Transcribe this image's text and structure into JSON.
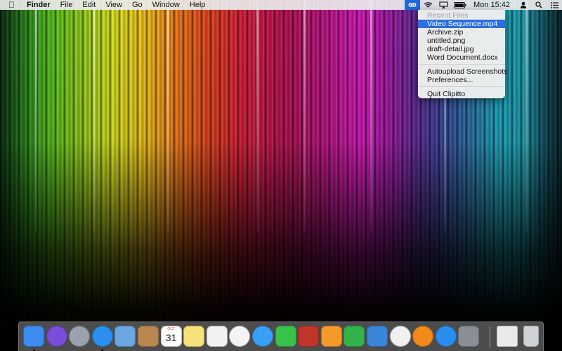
{
  "menubar": {
    "app_name": "Finder",
    "menus": [
      "File",
      "Edit",
      "View",
      "Go",
      "Window",
      "Help"
    ],
    "status_icons": [
      "clipitto-link-icon",
      "wifi-icon",
      "airplay-icon",
      "battery-icon"
    ],
    "clock": "Mon 15:42",
    "right_icons": [
      "user-icon",
      "search-icon",
      "list-icon"
    ]
  },
  "dropdown": {
    "header": "Recent Files",
    "recent_files": [
      "Video Sequence.mp4",
      "Archive.zip",
      "untitled.png",
      "draft-detail.jpg",
      "Word Document.docx"
    ],
    "selected_index": 0,
    "actions": [
      "Autoupload Screenshots",
      "Preferences..."
    ],
    "quit": "Quit Clipitto"
  },
  "dock": {
    "apps": [
      {
        "name": "finder-icon",
        "color": "#3d8df0",
        "running": true
      },
      {
        "name": "siri-icon",
        "color": "#7b4cd8",
        "running": false
      },
      {
        "name": "launchpad-icon",
        "color": "#9aa3ad",
        "running": false
      },
      {
        "name": "safari-icon",
        "color": "#2b8ff0",
        "running": true
      },
      {
        "name": "mail-icon",
        "color": "#6aa7e0",
        "running": false
      },
      {
        "name": "contacts-icon",
        "color": "#b9874f",
        "running": false
      },
      {
        "name": "calendar-icon",
        "color": "#ffffff",
        "running": false
      },
      {
        "name": "notes-icon",
        "color": "#f7e27a",
        "running": false
      },
      {
        "name": "reminders-icon",
        "color": "#f2f2f2",
        "running": false
      },
      {
        "name": "photos-icon",
        "color": "#f4f4f4",
        "running": false
      },
      {
        "name": "messages-icon",
        "color": "#3aa0f5",
        "running": false
      },
      {
        "name": "facetime-icon",
        "color": "#39c24a",
        "running": false
      },
      {
        "name": "photo-booth-icon",
        "color": "#c2352b",
        "running": false
      },
      {
        "name": "pages-icon",
        "color": "#f59a2a",
        "running": false
      },
      {
        "name": "numbers-icon",
        "color": "#34b24a",
        "running": false
      },
      {
        "name": "keynote-icon",
        "color": "#3a86d8",
        "running": false
      },
      {
        "name": "itunes-icon",
        "color": "#f0f0f0",
        "running": false
      },
      {
        "name": "ibooks-icon",
        "color": "#f28a1b",
        "running": false
      },
      {
        "name": "app-store-icon",
        "color": "#2a8ef0",
        "running": false
      },
      {
        "name": "system-preferences-icon",
        "color": "#8a8f96",
        "running": false
      }
    ],
    "calendar_month": "OCT",
    "calendar_day": "31",
    "right_items": [
      {
        "name": "downloads-stack-icon",
        "color": "#e9e9e9"
      },
      {
        "name": "trash-icon",
        "color": "#cfd3d6"
      }
    ]
  }
}
